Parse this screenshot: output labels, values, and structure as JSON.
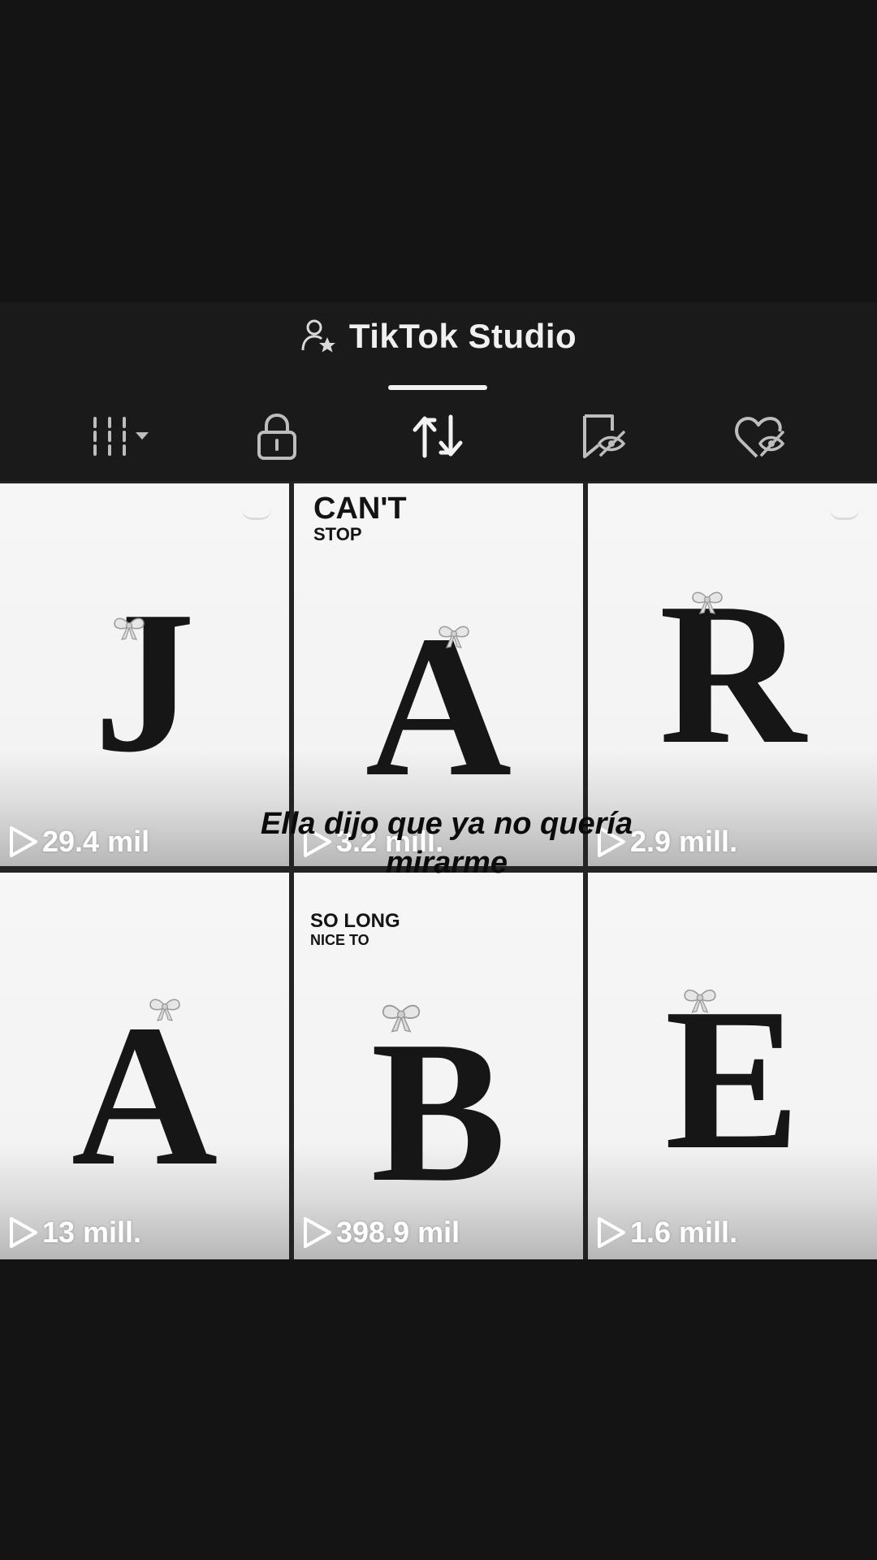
{
  "header": {
    "title": "TikTok Studio",
    "title_icon": "person-star-icon"
  },
  "tabs": [
    {
      "name": "tab-videos-grid",
      "icon": "grid-dropdown-icon",
      "active": false
    },
    {
      "name": "tab-private",
      "icon": "lock-icon",
      "active": false
    },
    {
      "name": "tab-reposts",
      "icon": "repost-icon",
      "active": true
    },
    {
      "name": "tab-favorites",
      "icon": "bookmark-hidden-icon",
      "active": false
    },
    {
      "name": "tab-liked",
      "icon": "heart-hidden-icon",
      "active": false
    }
  ],
  "videos": [
    {
      "letter": "J",
      "views": "29.4 mil",
      "caption_top": "",
      "caption_sub": ""
    },
    {
      "letter": "A",
      "views": "3.2 mill.",
      "caption_top": "CAN'T",
      "caption_sub": "STOP"
    },
    {
      "letter": "R",
      "views": "2.9 mill.",
      "caption_top": "",
      "caption_sub": ""
    },
    {
      "letter": "A",
      "views": "13 mill.",
      "caption_top": "",
      "caption_sub": ""
    },
    {
      "letter": "B",
      "views": "398.9 mil",
      "caption_top": "SO LONG",
      "caption_sub": "NICE TO"
    },
    {
      "letter": "E",
      "views": "1.6 mill.",
      "caption_top": "",
      "caption_sub": ""
    }
  ],
  "overlay_subtitle": "Ella dijo que ya no quería mirarme",
  "colors": {
    "background": "#141414",
    "header": "#1a1a1a",
    "tile": "#f4f4f4",
    "letter": "#161616",
    "indicator": "#f2f2f2"
  }
}
